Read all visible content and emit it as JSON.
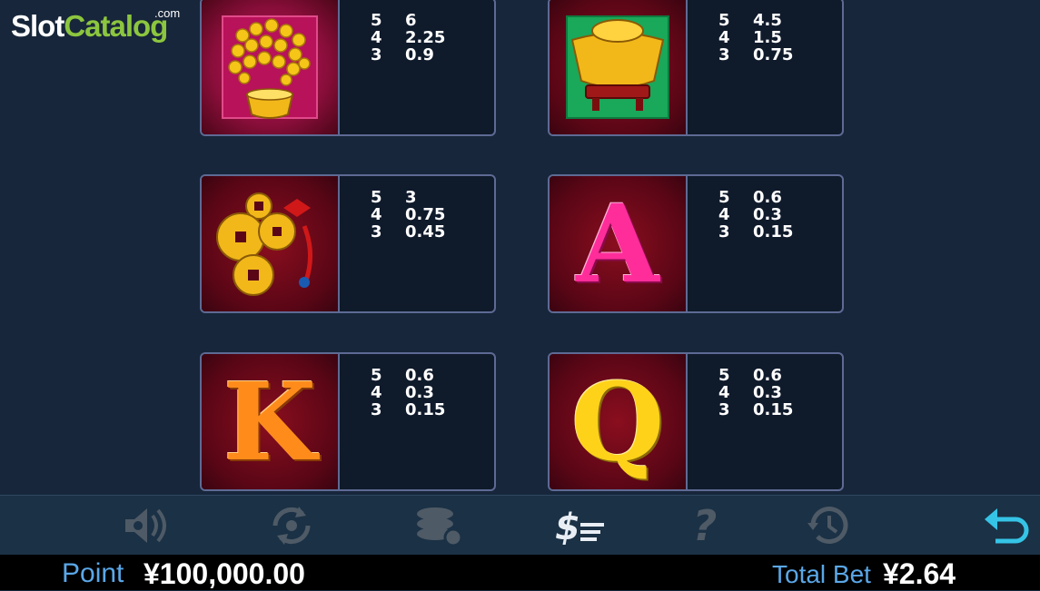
{
  "branding": {
    "logo_slot": "Slot",
    "logo_catalog": "Catalog",
    "logo_com": ".com"
  },
  "paytable": [
    {
      "symbol": "money-tree",
      "pays": [
        {
          "count": "5",
          "value": "6"
        },
        {
          "count": "4",
          "value": "2.25"
        },
        {
          "count": "3",
          "value": "0.9"
        }
      ]
    },
    {
      "symbol": "gold-ingot",
      "pays": [
        {
          "count": "5",
          "value": "4.5"
        },
        {
          "count": "4",
          "value": "1.5"
        },
        {
          "count": "3",
          "value": "0.75"
        }
      ]
    },
    {
      "symbol": "lucky-coins",
      "pays": [
        {
          "count": "5",
          "value": "3"
        },
        {
          "count": "4",
          "value": "0.75"
        },
        {
          "count": "3",
          "value": "0.45"
        }
      ]
    },
    {
      "symbol": "letter-a",
      "letter": "A",
      "pays": [
        {
          "count": "5",
          "value": "0.6"
        },
        {
          "count": "4",
          "value": "0.3"
        },
        {
          "count": "3",
          "value": "0.15"
        }
      ]
    },
    {
      "symbol": "letter-k",
      "letter": "K",
      "pays": [
        {
          "count": "5",
          "value": "0.6"
        },
        {
          "count": "4",
          "value": "0.3"
        },
        {
          "count": "3",
          "value": "0.15"
        }
      ]
    },
    {
      "symbol": "letter-q",
      "letter": "Q",
      "pays": [
        {
          "count": "5",
          "value": "0.6"
        },
        {
          "count": "4",
          "value": "0.3"
        },
        {
          "count": "3",
          "value": "0.15"
        }
      ]
    }
  ],
  "toolbar": {
    "icons": [
      "sound-settings-icon",
      "autoplay-icon",
      "chips-settings-icon",
      "paytable-icon",
      "help-icon",
      "history-icon",
      "back-icon"
    ],
    "help_glyph": "?"
  },
  "footer": {
    "point_label": "Point",
    "point_value": "¥100,000.00",
    "total_bet_label": "Total Bet",
    "total_bet_value": "¥2.64"
  },
  "colors": {
    "background": "#17263a",
    "card_border": "#5e6a94",
    "label_blue": "#5aa7e8",
    "active_icon": "#35c4e6"
  }
}
